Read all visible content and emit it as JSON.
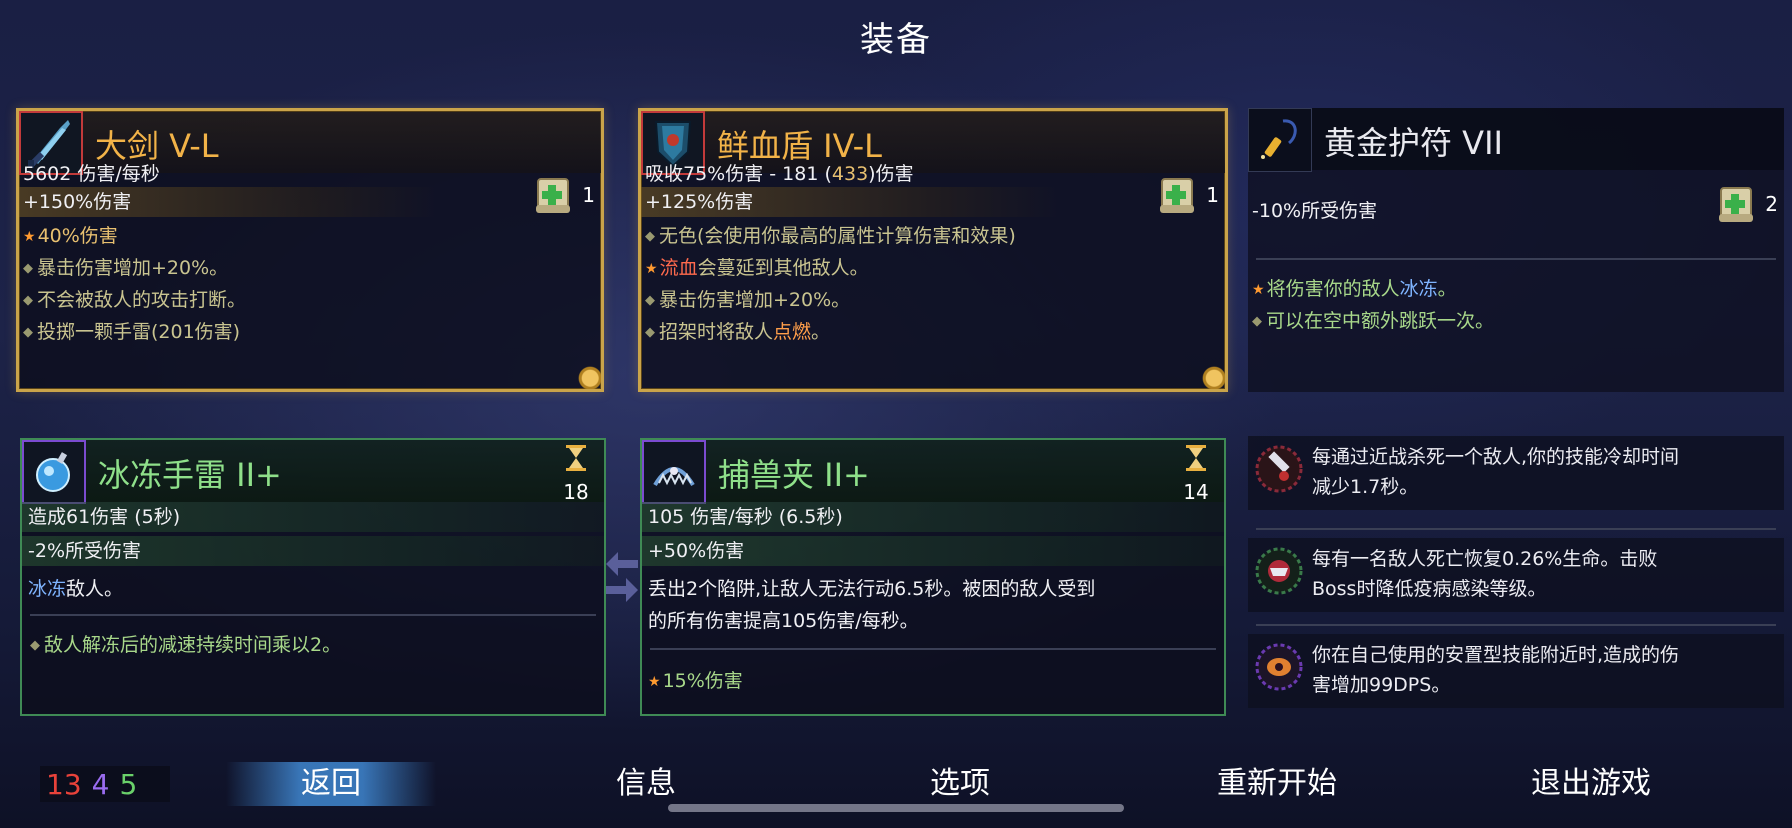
{
  "title": "装备",
  "cards": {
    "greatsword": {
      "name": "大剑 V-L",
      "scroll_count": "1",
      "lines": {
        "dps": "5602 伤害/每秒",
        "bonus": "+150%伤害",
        "star": "40%伤害",
        "aff1": "暴击伤害增加+20%。",
        "aff2": "不会被敌人的攻击打断。",
        "aff3": "投掷一颗手雷(201伤害)"
      }
    },
    "bloodshield": {
      "name": "鲜血盾 IV-L",
      "scroll_count": "1",
      "lines": {
        "absorb_a": "吸收75%伤害 - 181 (",
        "absorb_num": "433",
        "absorb_b": ")伤害",
        "bonus": "+125%伤害",
        "aff1": "无色(会使用你最高的属性计算伤害和效果)",
        "star_red": "流血",
        "star_rest": "会蔓延到其他敌人。",
        "aff2": "暴击伤害增加+20%。",
        "aff3_a": "招架时将敌人",
        "aff3_b": "点燃",
        "aff3_c": "。"
      }
    },
    "amulet": {
      "name": "黄金护符 VII",
      "scroll_count": "2",
      "lines": {
        "stat": "-10%所受伤害",
        "star_a": "将伤害你的敌人",
        "star_b": "冰冻",
        "star_c": "。",
        "aff1": "可以在空中额外跳跃一次。"
      }
    },
    "icegrenade": {
      "name": "冰冻手雷 II+",
      "cooldown": "18",
      "lines": {
        "dmg": "造成61伤害 (5秒)",
        "stat": "-2%所受伤害",
        "desc_a": "冰冻",
        "desc_b": "敌人。",
        "aff1": "敌人解冻后的减速持续时间乘以2。"
      }
    },
    "beartrap": {
      "name": "捕兽夹 II+",
      "cooldown": "14",
      "lines": {
        "dps": "105 伤害/每秒 (6.5秒)",
        "bonus": "+50%伤害",
        "desc1": "丢出2个陷阱,让敌人无法行动6.5秒。被困的敌人受到",
        "desc2": "的所有伤害提高105伤害/每秒。",
        "star": "15%伤害"
      }
    }
  },
  "perks": [
    {
      "line1": "每通过近战杀死一个敌人,你的技能冷却时间",
      "line2": "减少1.7秒。"
    },
    {
      "line1": "每有一名敌人死亡恢复0.26%生命。击败",
      "line2": "Boss时降低疫病感染等级。"
    },
    {
      "line1": "你在自己使用的安置型技能附近时,造成的伤",
      "line2": "害增加99DPS。"
    }
  ],
  "stats": {
    "brutality": "13",
    "tactics": "4",
    "survival": "5"
  },
  "menu": {
    "back": "返回",
    "info": "信息",
    "options": "选项",
    "restart": "重新开始",
    "quit": "退出游戏"
  },
  "colors": {
    "gold_border": "#caa44a",
    "green_border": "#3f8a55",
    "brutality": "#e8423a",
    "tactics": "#9a6cf0",
    "survival": "#6ad06a"
  }
}
